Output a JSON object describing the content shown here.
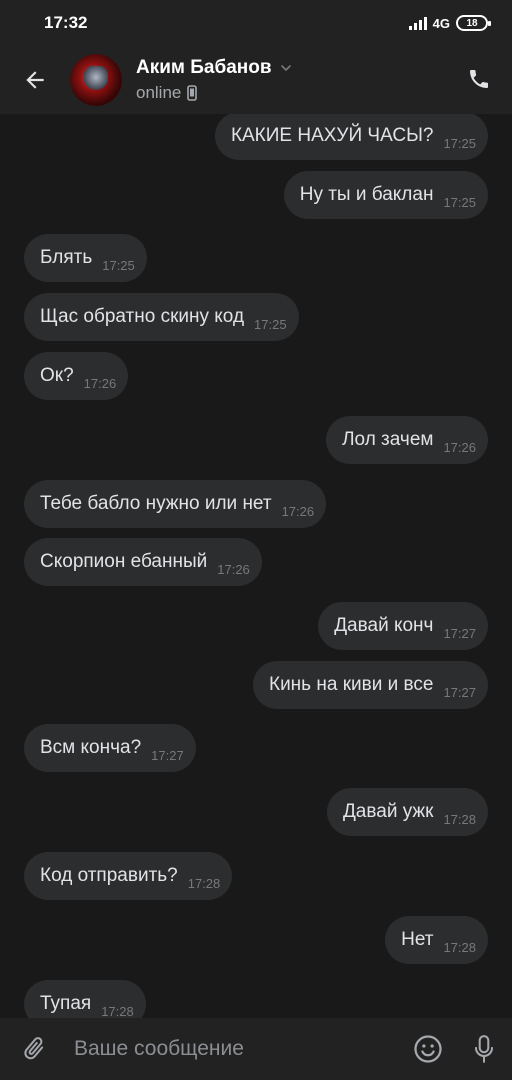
{
  "status_bar": {
    "time": "17:32",
    "network": "4G",
    "battery": "18"
  },
  "header": {
    "back_icon": "arrow-left-icon",
    "contact_name": "Аким Бабанов",
    "status": "online",
    "call_icon": "phone-icon"
  },
  "messages": [
    {
      "direction": "out",
      "text": "КАКИЕ НАХУЙ ЧАСЫ?",
      "time": "17:25"
    },
    {
      "direction": "out",
      "text": "Ну ты и баклан",
      "time": "17:25"
    },
    {
      "direction": "in",
      "text": "Блять",
      "time": "17:25"
    },
    {
      "direction": "in",
      "text": "Щас обратно скину код",
      "time": "17:25"
    },
    {
      "direction": "in",
      "text": "Ок?",
      "time": "17:26"
    },
    {
      "direction": "out",
      "text": "Лол зачем",
      "time": "17:26"
    },
    {
      "direction": "in",
      "text": "Тебе бабло нужно или нет",
      "time": "17:26"
    },
    {
      "direction": "in",
      "text": "Скорпион ебанный",
      "time": "17:26"
    },
    {
      "direction": "out",
      "text": "Давай конч",
      "time": "17:27"
    },
    {
      "direction": "out",
      "text": "Кинь на киви и все",
      "time": "17:27"
    },
    {
      "direction": "in",
      "text": "Всм конча?",
      "time": "17:27"
    },
    {
      "direction": "out",
      "text": "Давай ужк",
      "time": "17:28"
    },
    {
      "direction": "in",
      "text": "Код отправить?",
      "time": "17:28"
    },
    {
      "direction": "out",
      "text": "Нет",
      "time": "17:28"
    },
    {
      "direction": "in",
      "text": "Тупая",
      "time": "17:28"
    }
  ],
  "composer": {
    "placeholder": "Ваше сообщение",
    "attach_icon": "paperclip-icon",
    "emoji_icon": "smiley-icon",
    "mic_icon": "microphone-icon"
  },
  "colors": {
    "background": "#19191a",
    "bars": "#222222",
    "bubble": "#2c2d2e",
    "text": "#e1e3e6",
    "time_text": "#76787a"
  }
}
